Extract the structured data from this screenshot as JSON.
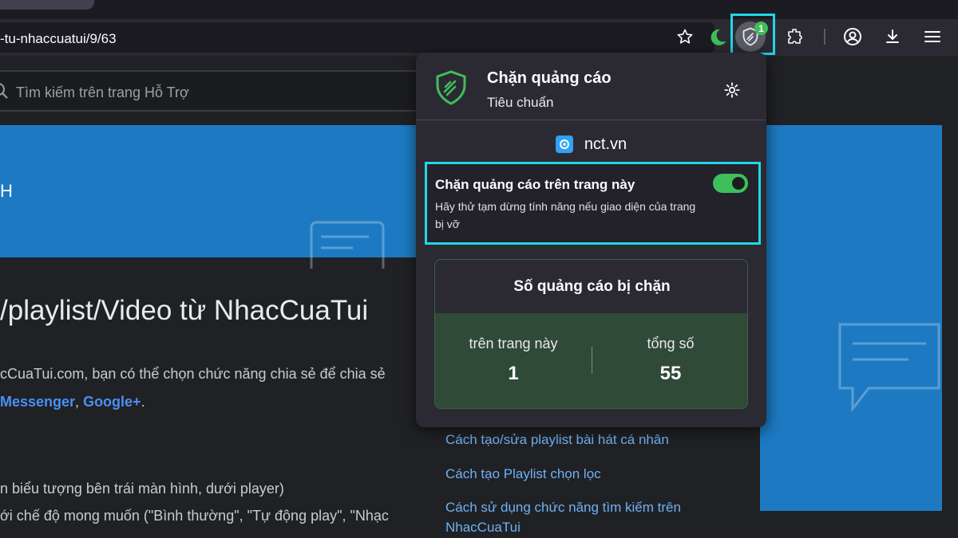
{
  "browser": {
    "url": "-tu-nhaccuatui/9/63",
    "extension_badge": "1"
  },
  "page": {
    "search_placeholder": "Tìm kiếm trên trang Hỗ Trợ",
    "banner_text": "H",
    "title": "/playlist/Video từ NhacCuaTui",
    "body_line1": "cCuaTui.com, bạn có thể chọn chức năng chia sẻ để chia sẻ",
    "body_link1": "Messenger",
    "body_sep": ", ",
    "body_link2": "Google+",
    "body_end": ".",
    "body_line3": "n biểu tượng bên trái màn hình, dưới player)",
    "body_line4": "ới chế độ mong muốn (\"Bình thường\", \"Tự động play\", \"Nhạc",
    "side_links": [
      "Cách tạo/sửa playlist bài hát cá nhân",
      "Cách tạo Playlist chọn lọc",
      "Cách sử dụng chức năng tìm kiếm trên",
      "NhacCuaTui"
    ]
  },
  "popup": {
    "title": "Chặn quảng cáo",
    "subtitle": "Tiêu chuẩn",
    "site": "nct.vn",
    "toggle_title": "Chặn quảng cáo trên trang này",
    "toggle_desc": "Hãy thử tạm dừng tính năng nếu giao diện của trang bị vỡ",
    "toggle_on": true,
    "stats_title": "Số quảng cáo bị chặn",
    "stat_page_label": "trên trang này",
    "stat_page_value": "1",
    "stat_total_label": "tổng số",
    "stat_total_value": "55"
  },
  "colors": {
    "accent": "#22d6e8",
    "shield_green": "#3fbf5a",
    "banner_blue": "#1d7ac2"
  }
}
